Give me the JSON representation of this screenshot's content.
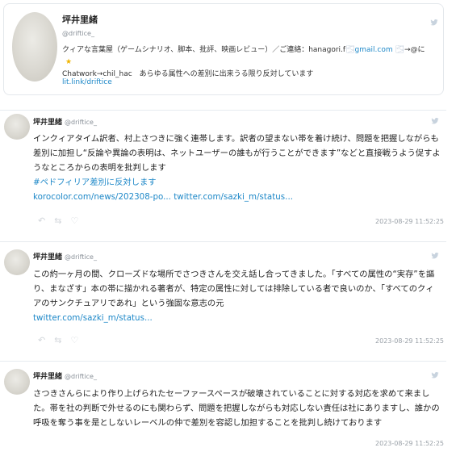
{
  "profile": {
    "name": "坪井里緒",
    "handle": "@driftice_",
    "bio_line1": "クィアな言葉屋（ゲームシナリオ、脚本、批評、映画レビュー）／ご連絡：hanagori.f",
    "bio_email_tail": "gmail.com",
    "bio_line1_tail": "→@に",
    "bio_line2": "Chatwork→chil_hac　あらゆる属性への差別に出来うる限り反対しています",
    "link": "lit.link/driftice"
  },
  "tweets": [
    {
      "name": "坪井里緒",
      "handle": "@driftice_",
      "text": "インクィアタイム訳者、村上さつきに強く連帯します。訳者の望まない帯を着け続け、問題を把握しながらも差別に加担し“反論や異論の表明は、ネットユーザーの誰もが行うことができます”などと直接戦うよう促すようなところからの表明を批判します",
      "hashtag": "#ペドフィリア差別に反対します",
      "links": "korocolor.com/news/202308-po... twitter.com/sazki_m/status...",
      "date": "2023-08-29 11:52:25"
    },
    {
      "name": "坪井里緒",
      "handle": "@driftice_",
      "text": "この約一ヶ月の間、クローズドな場所でさつきさんを交え話し合ってきました。「すべての属性の“実存”を謳り、まなざす」本の帯に描かれる著者が、特定の属性に対しては排除している者で良いのか、「すべてのクィアのサンクチュアリであれ」という強固な意志の元",
      "hashtag": "",
      "links": "twitter.com/sazki_m/status...",
      "date": "2023-08-29 11:52:25"
    },
    {
      "name": "坪井里緒",
      "handle": "@driftice_",
      "text": "さつきさんらにより作り上げられたセーファースペースが破壊されていることに対する対応を求めて来ました。帯を社の判断で外せるのにも関わらず、問題を把握しながらも対応しない責任は社にありますし、誰かの呼吸を奪う事を是としないレーベルの仲で差別を容認し加担することを批判し続けております",
      "hashtag": "",
      "links": "",
      "date": "2023-08-29 11:52:25"
    }
  ],
  "actions": [
    "reply-icon",
    "retweet-icon",
    "like-icon"
  ],
  "colors": {
    "link": "#1e88c8",
    "muted": "#8a9199",
    "star": "#f0b400"
  }
}
